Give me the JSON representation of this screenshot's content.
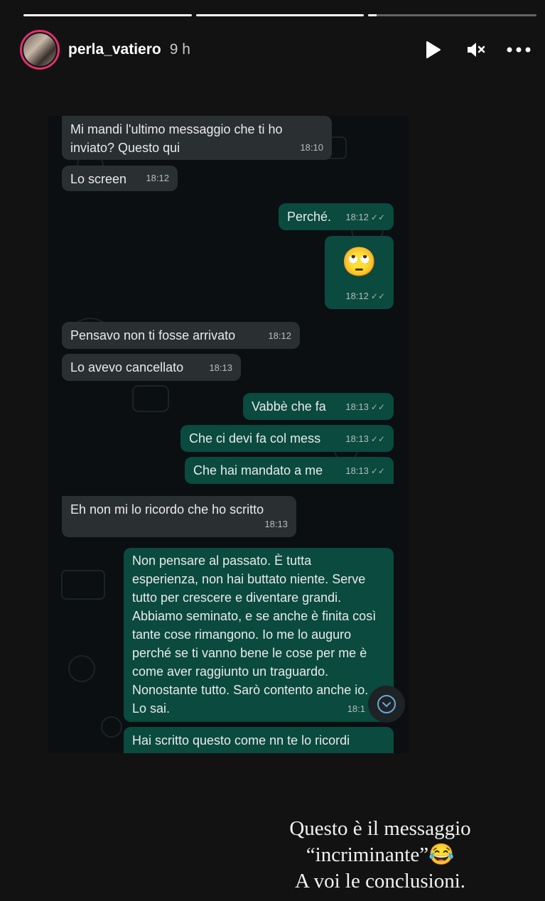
{
  "story": {
    "username": "perla_vatiero",
    "time_ago": "9 h",
    "progress": [
      1.0,
      1.0,
      0.05
    ],
    "icons": {
      "play": "play-icon",
      "mute": "muted-speaker-icon",
      "more": "more-dots-icon"
    }
  },
  "chat": {
    "messages": [
      {
        "dir": "in",
        "text": "Mi mandi l'ultimo messaggio che ti ho inviato? Questo qui",
        "time": "18:10"
      },
      {
        "dir": "in",
        "text": "Lo screen",
        "time": "18:12"
      },
      {
        "dir": "out",
        "text": "Perché.",
        "time": "18:12"
      },
      {
        "dir": "out",
        "text": "🙄",
        "time": "18:12"
      },
      {
        "dir": "in",
        "text": "Pensavo non ti fosse arrivato",
        "time": "18:12"
      },
      {
        "dir": "in",
        "text": "Lo avevo cancellato",
        "time": "18:13"
      },
      {
        "dir": "out",
        "text": "Vabbè che fa",
        "time": "18:13"
      },
      {
        "dir": "out",
        "text": "Che ci devi fa col mess",
        "time": "18:13"
      },
      {
        "dir": "out",
        "text": "Che hai mandato a me",
        "time": "18:13"
      },
      {
        "dir": "in",
        "text": "Eh non mi lo ricordo che ho scritto",
        "time": "18:13"
      },
      {
        "dir": "out",
        "text": "Non pensare al passato. È tutta esperienza, non hai buttato niente. Serve tutto per crescere e diventare grandi. Abbiamo seminato, e se anche è finita così tante cose rimangono. Io me lo auguro perché se ti vanno bene le cose per me è come aver raggiunto un traguardo. Nonostante tutto. Sarò contento anche io. Lo sai.",
        "time": "18:1"
      },
      {
        "dir": "out",
        "text": "Hai scritto questo come nn te lo ricordi",
        "time": ""
      }
    ],
    "scroll_icon": "chevron-down-icon"
  },
  "caption": {
    "line1": "Questo è il messaggio",
    "line2": "“incriminante”😂",
    "line3": "A voi le conclusioni."
  },
  "colors": {
    "incoming": "#2a2f32",
    "outgoing": "#0a4a3f",
    "story_ring": "#e1306c"
  }
}
